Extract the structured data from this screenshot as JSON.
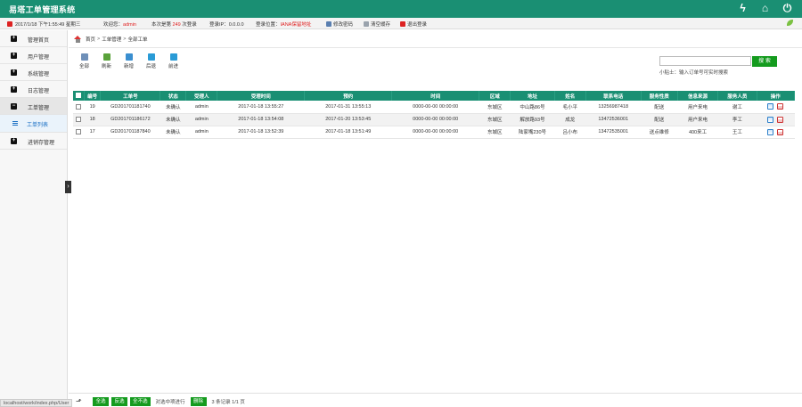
{
  "app": {
    "title": "易塔工单管理系统"
  },
  "infobar": {
    "datetime": "2017/1/18 下午1:55:49 星期三",
    "welcome_prefix": "欢迎您：",
    "user": "admin",
    "login_count_prefix": "本次是第",
    "login_count": "249",
    "login_count_suffix": "次登录",
    "login_ip": "登录IP：0.0.0.0",
    "location_prefix": "登录位置：",
    "location": "IANA保留地址",
    "change_password": "修改密码",
    "clear_cache": "清空缓存",
    "logout": "退出登录"
  },
  "sidebar": {
    "items": [
      {
        "label": "管理首页"
      },
      {
        "label": "用户管理"
      },
      {
        "label": "系统管理"
      },
      {
        "label": "日志管理"
      },
      {
        "label": "工单管理"
      },
      {
        "label": "进销存管理"
      }
    ],
    "sub_item": "工单列表"
  },
  "breadcrumb": {
    "home": "首页",
    "level1": "工单管理",
    "level2": "全部工单",
    "sep": ">"
  },
  "toolbar": {
    "all": "全部",
    "refresh": "刷新",
    "new": "新增",
    "back": "后退",
    "forward": "前进"
  },
  "search": {
    "button": "搜 索",
    "tip": "小贴士：输入订单号可实时搜索",
    "value": ""
  },
  "table": {
    "headers": [
      "编号",
      "工单号",
      "状态",
      "受理人",
      "受理时间",
      "预约",
      "时间",
      "区域",
      "地址",
      "姓名",
      "联系电话",
      "服务性质",
      "信息来源",
      "服务人员",
      "操作"
    ],
    "rows": [
      [
        "19",
        "GD201701181740",
        "未确认",
        "admin",
        "2017-01-18 13:55:27",
        "2017-01-31 13:55:13",
        "0000-00-00 00:00:00",
        "东城区",
        "中山路86号",
        "毛小平",
        "13256987418",
        "配送",
        "用户来电",
        "谢工"
      ],
      [
        "18",
        "GD201701186172",
        "未确认",
        "admin",
        "2017-01-18 13:54:08",
        "2017-01-20 13:53:45",
        "0000-00-00 00:00:00",
        "东城区",
        "解放路93号",
        "成龙",
        "13472536001",
        "配送",
        "用户来电",
        "李工"
      ],
      [
        "17",
        "GD201701187840",
        "未确认",
        "admin",
        "2017-01-18 13:52:39",
        "2017-01-18 13:51:49",
        "0000-00-00 00:00:00",
        "东城区",
        "陆家嘴230号",
        "吕小布",
        "13472535001",
        "送点维修",
        "400来工",
        "王工"
      ]
    ]
  },
  "footer": {
    "btn1": "全选",
    "btn2": "反选",
    "btn3": "全不选",
    "text": "对选中项进行",
    "delete": "删除",
    "summary": "3 条记录 1/1 页"
  },
  "status_url": "localhost/work/index.php/User"
}
